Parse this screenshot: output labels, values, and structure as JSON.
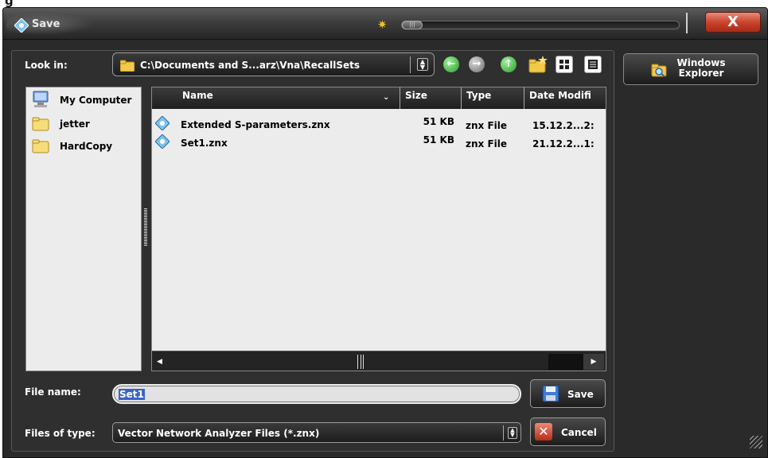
{
  "window": {
    "title": "Save",
    "close_label": "X",
    "brightness_level_percent": 0
  },
  "toolbar": {
    "look_in_label": "Look in:",
    "look_in_path": "C:\\Documents and S...arz\\Vna\\RecallSets",
    "back_icon": "arrow-left-icon",
    "forward_icon": "arrow-right-icon",
    "up_icon": "arrow-up-icon",
    "new_folder_icon": "new-folder-icon",
    "view_grid_icon": "grid-view-icon",
    "view_list_icon": "list-view-icon"
  },
  "right_panel": {
    "windows_explorer_line1": "Windows",
    "windows_explorer_line2": "Explorer"
  },
  "places": [
    {
      "label": "My Computer",
      "icon": "computer-icon"
    },
    {
      "label": "jetter",
      "icon": "folder-icon"
    },
    {
      "label": "HardCopy",
      "icon": "folder-icon"
    }
  ],
  "file_list": {
    "columns": [
      "Name",
      "Size",
      "Type",
      "Date Modifi"
    ],
    "rows": [
      {
        "name": "Extended S-parameters.znx",
        "size": "51 KB",
        "type": "znx File",
        "date": "15.12.2...2:"
      },
      {
        "name": "Set1.znx",
        "size": "51 KB",
        "type": "znx File",
        "date": "21.12.2...1:"
      }
    ]
  },
  "form": {
    "file_name_label": "File name:",
    "file_name_value": "Set1",
    "files_of_type_label": "Files of type:",
    "files_of_type_value": "Vector Network Analyzer Files (*.znx)",
    "save_label": "Save",
    "cancel_label": "Cancel"
  },
  "colors": {
    "selection": "#3a64c8",
    "close_button": "#c9442d",
    "accent_green": "#2a9a2a"
  }
}
